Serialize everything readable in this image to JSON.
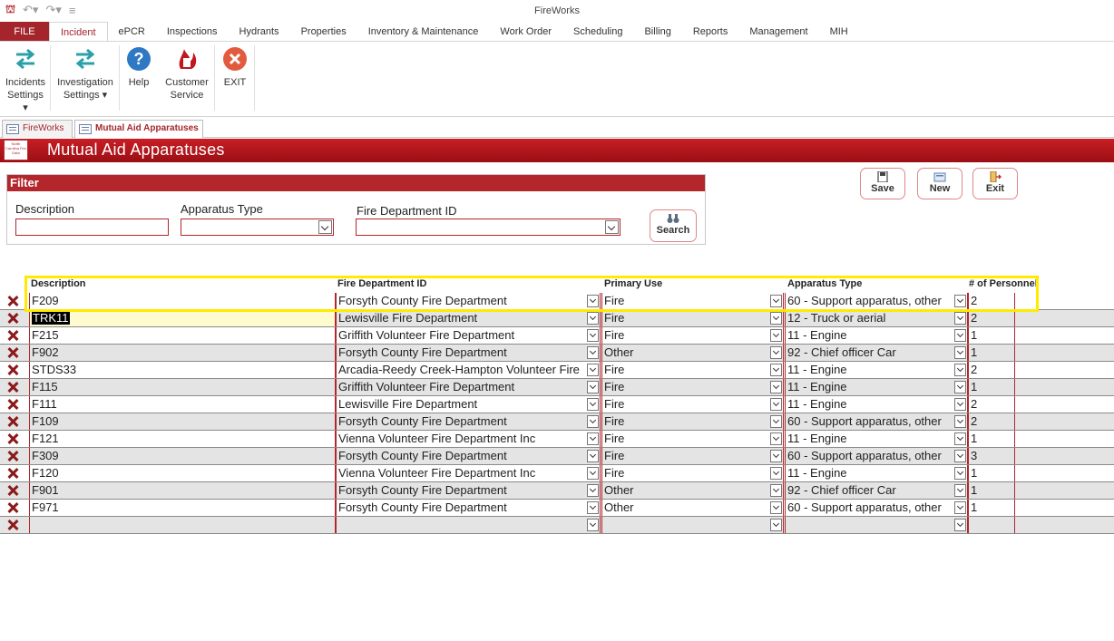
{
  "app_title": "FireWorks",
  "ribbon_tabs": [
    "FILE",
    "Incident",
    "ePCR",
    "Inspections",
    "Hydrants",
    "Properties",
    "Inventory & Maintenance",
    "Work Order",
    "Scheduling",
    "Billing",
    "Reports",
    "Management",
    "MIH"
  ],
  "active_tab": "Incident",
  "ribbon_buttons": {
    "incidents_settings": {
      "line1": "Incidents",
      "line2": "Settings ▾"
    },
    "investigation_settings": {
      "line1": "Investigation",
      "line2": "Settings ▾"
    },
    "help": {
      "line1": "Help"
    },
    "customer_service": {
      "line1": "Customer",
      "line2": "Service"
    },
    "exit": {
      "line1": "EXIT"
    }
  },
  "doc_tabs": {
    "first": "FireWorks",
    "second": "Mutual Aid Apparatuses"
  },
  "form_title": "Mutual Aid Apparatuses",
  "logo_text": "North Carolina Fire Data",
  "filter": {
    "heading": "Filter",
    "description_label": "Description",
    "apparatus_type_label": "Apparatus Type",
    "fire_dept_label": "Fire Department ID",
    "search_label": "Search"
  },
  "actions": {
    "save": "Save",
    "new": "New",
    "exit": "Exit"
  },
  "grid": {
    "columns": [
      "Description",
      "Fire Department ID",
      "Primary Use",
      "Apparatus Type",
      "# of Personnel"
    ],
    "rows": [
      {
        "description": "F209",
        "dept": "Forsyth County Fire Department",
        "use": "Fire",
        "type": "60 - Support apparatus, other",
        "personnel": "2"
      },
      {
        "description": "TRK11",
        "dept": "Lewisville Fire Department",
        "use": "Fire",
        "type": "12 - Truck or aerial",
        "personnel": "2"
      },
      {
        "description": "F215",
        "dept": "Griffith Volunteer Fire Department",
        "use": "Fire",
        "type": "11 - Engine",
        "personnel": "1"
      },
      {
        "description": "F902",
        "dept": "Forsyth County Fire Department",
        "use": "Other",
        "type": "92 - Chief officer Car",
        "personnel": "1"
      },
      {
        "description": "STDS33",
        "dept": "Arcadia-Reedy Creek-Hampton Volunteer Fire",
        "use": "Fire",
        "type": "11 - Engine",
        "personnel": "2"
      },
      {
        "description": "F115",
        "dept": "Griffith Volunteer Fire Department",
        "use": "Fire",
        "type": "11 - Engine",
        "personnel": "1"
      },
      {
        "description": "F111",
        "dept": "Lewisville Fire Department",
        "use": "Fire",
        "type": "11 - Engine",
        "personnel": "2"
      },
      {
        "description": "F109",
        "dept": "Forsyth County Fire Department",
        "use": "Fire",
        "type": "60 - Support apparatus, other",
        "personnel": "2"
      },
      {
        "description": "F121",
        "dept": "Vienna Volunteer Fire Department Inc",
        "use": "Fire",
        "type": "11 - Engine",
        "personnel": "1"
      },
      {
        "description": "F309",
        "dept": "Forsyth County Fire Department",
        "use": "Fire",
        "type": "60 - Support apparatus, other",
        "personnel": "3"
      },
      {
        "description": "F120",
        "dept": "Vienna Volunteer Fire Department Inc",
        "use": "Fire",
        "type": "11 - Engine",
        "personnel": "1"
      },
      {
        "description": "F901",
        "dept": "Forsyth County Fire Department",
        "use": "Other",
        "type": "92 - Chief officer Car",
        "personnel": "1"
      },
      {
        "description": "F971",
        "dept": "Forsyth County Fire Department",
        "use": "Other",
        "type": "60 - Support apparatus, other",
        "personnel": "1"
      },
      {
        "description": "",
        "dept": "",
        "use": "",
        "type": "",
        "personnel": ""
      }
    ]
  }
}
